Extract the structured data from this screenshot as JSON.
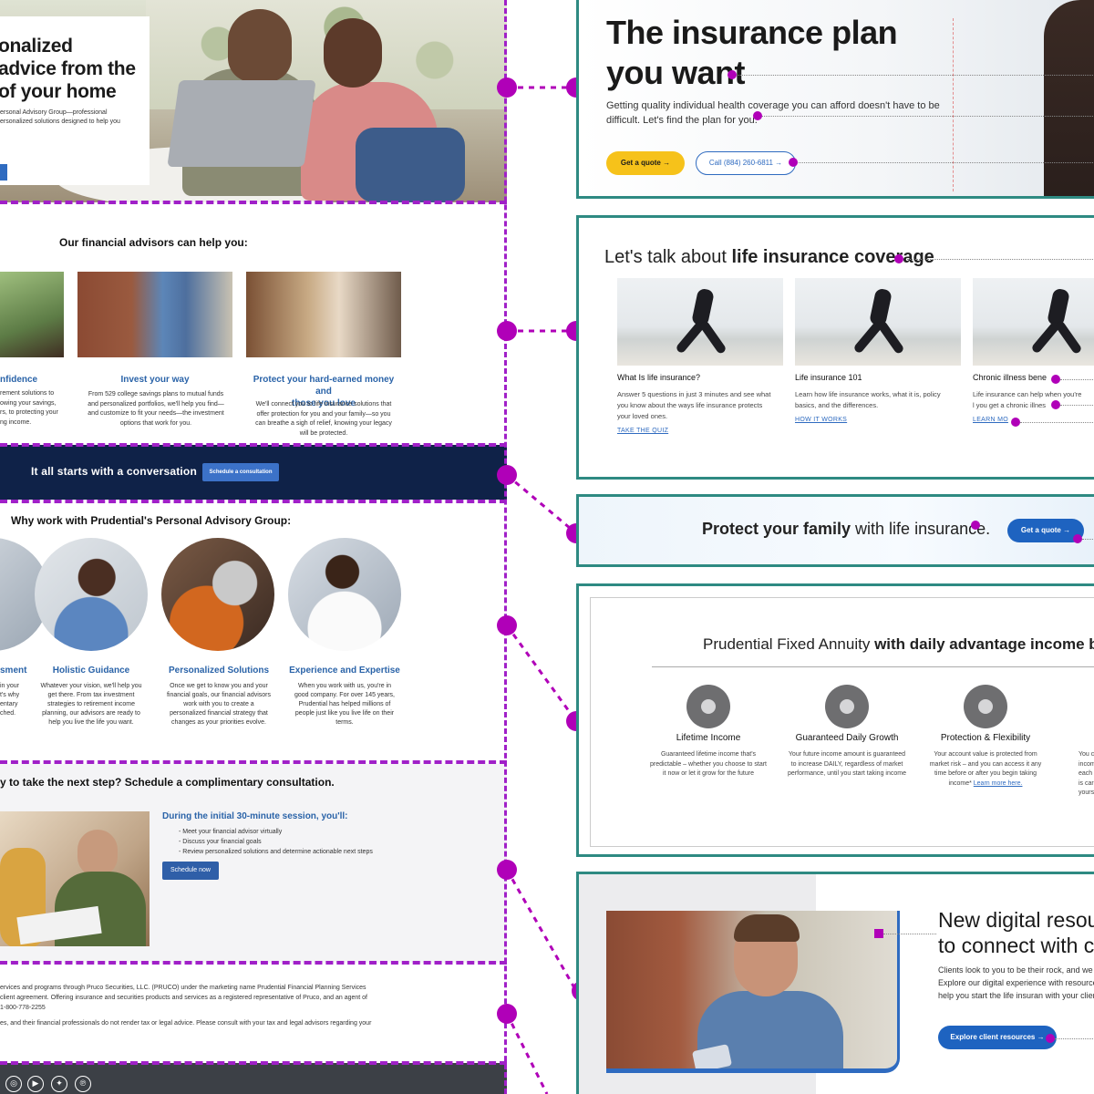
{
  "left": {
    "hero": {
      "title": "onalized\nadvice from the\nof your home",
      "subtitle": "ersonal Advisory Group—professional\nersonalized solutions designed to help you"
    },
    "advisors": {
      "title": "Our financial advisors can help you:",
      "columns": [
        {
          "title": "nfidence",
          "text": "rement solutions to\nowing your savings,\nrs, to protecting your\nng income."
        },
        {
          "title": "Invest your way",
          "text": "From 529 college savings plans to mutual funds\nand personalized portfolios, we'll help you find—\nand customize to fit your needs—the investment\noptions that work for you."
        },
        {
          "title": "Protect your hard-earned money and\nthose you love",
          "text": "We'll connect you to life insurance solutions that\noffer protection for you and your family—so you\ncan breathe a sigh of relief, knowing your legacy\nwill be protected."
        }
      ]
    },
    "band": {
      "text": "It all starts with a conversation",
      "button": "Schedule a consultation"
    },
    "why": {
      "title": "Why work with Prudential's Personal Advisory Group:",
      "columns": [
        {
          "title": "sment",
          "text": "in your\nt's why\nentary\nched."
        },
        {
          "title": "Holistic Guidance",
          "text": "Whatever your vision, we'll help you\nget there. From tax investment\nstrategies to retirement income\nplanning, our advisors are ready to\nhelp you live the life you want."
        },
        {
          "title": "Personalized Solutions",
          "text": "Once we get to know you and your\nfinancial goals, our financial advisors\nwork with you to create a\npersonalized financial strategy that\nchanges as your priorities evolve."
        },
        {
          "title": "Experience and Expertise",
          "text": "When you work with us, you're in\ngood company. For over 145 years,\nPrudential has helped millions of\npeople just like you live life on their\nterms."
        }
      ]
    },
    "next_step": {
      "title": "y to take the next step? Schedule a complimentary consultation.",
      "session_title": "During the initial 30-minute session, you'll:",
      "list": [
        "- Meet your financial advisor virtually",
        "- Discuss your financial goals",
        "- Review personalized solutions and determine actionable next steps"
      ],
      "button": "Schedule now"
    },
    "disclaimer": {
      "p1": "ervices and programs through Pruco Securities, LLC. (PRUCO) under the marketing name Prudential Financial Planning Services\nclient agreement. Offering insurance and securities products and services as a registered representative of Pruco, and an agent of\n1-800-778-2255",
      "p2": "es, and their financial professionals do not render tax or legal advice. Please consult with your tax and legal advisors regarding your"
    },
    "social_icons": [
      "instagram-icon",
      "youtube-icon",
      "twitter-icon",
      "pinterest-icon"
    ]
  },
  "right": {
    "hero": {
      "title": "The insurance plan\nyou want",
      "subtitle": "Getting quality individual health coverage you can afford doesn't have to be difficult. Let's find the plan for you.",
      "btn_quote": "Get a quote  →",
      "btn_call": "Call (884) 260-6811  →"
    },
    "life": {
      "title_light": "Let's talk about ",
      "title_bold": "life insurance coverage",
      "cards": [
        {
          "title": "What Is life insurance?",
          "text": "Answer 5 questions in just 3 minutes and see what you know about the ways life insurance protects your loved ones.",
          "link": "TAKE THE QUIZ"
        },
        {
          "title": "Life insurance 101",
          "text": "Learn how life insurance works, what it is, policy basics, and the differences.",
          "link": "HOW IT WORKS"
        },
        {
          "title": "Chronic illness bene",
          "text": "Life insurance can help when you're l you get a chronic illnes",
          "link": "LEARN MO"
        }
      ]
    },
    "protect": {
      "bold": "Protect your family",
      "light": " with life insurance.",
      "button": "Get a quote  →"
    },
    "annuity": {
      "title_light": "Prudential Fixed Annuity ",
      "title_bold": "with daily advantage income be",
      "features": [
        {
          "title": "Lifetime Income",
          "text": "Guaranteed lifetime income that's predictable – whether you choose to start it now or let it grow for the future"
        },
        {
          "title": "Guaranteed Daily Growth",
          "text": "Your future income amount is guaranteed to increase DAILY, regardless of market performance, until you start taking income"
        },
        {
          "title": "Protection & Flexibility",
          "text": "Your account value is protected from market risk – and you can access it any time before or after you begin taking income*",
          "link": "Learn more here."
        },
        {
          "title": "",
          "text": "You c income a each yea is carried yours to"
        }
      ]
    },
    "digital": {
      "title": "New digital resou\nto connect with c",
      "text": "Clients look to you to be their rock, and we yours. Explore our digital experience with resources to help you start the life insuran with your clients.",
      "button": "Explore client resources  →"
    }
  }
}
